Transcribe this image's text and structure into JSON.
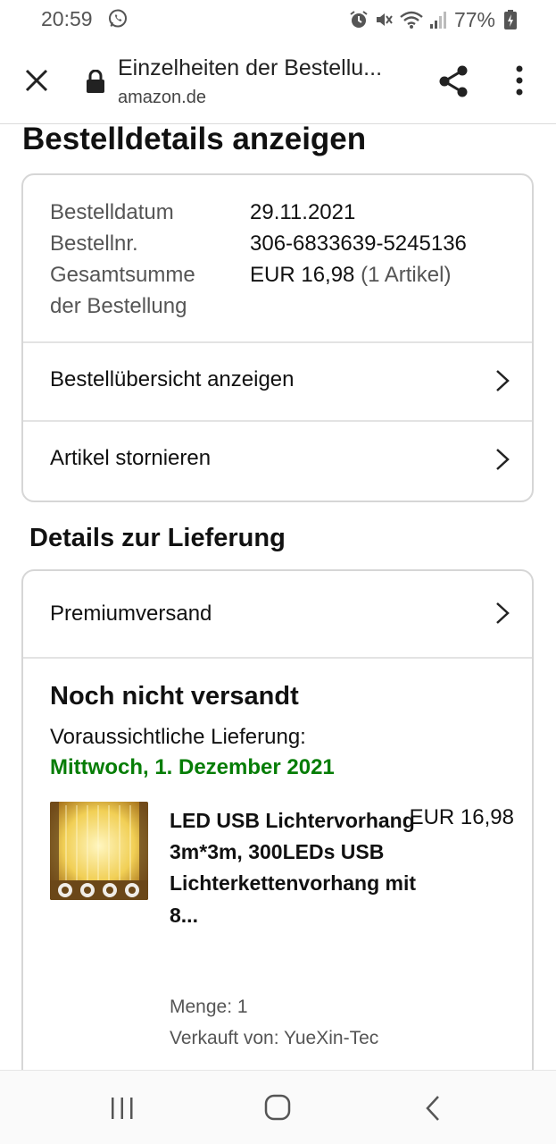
{
  "status_bar": {
    "time": "20:59",
    "battery": "77%",
    "icons": [
      "whatsapp-icon",
      "alarm-icon",
      "mute-icon",
      "wifi-icon",
      "signal-icon",
      "battery-charging-icon"
    ]
  },
  "toolbar": {
    "title": "Einzelheiten der Bestellu...",
    "url": "amazon.de",
    "icons": [
      "close-icon",
      "lock-icon",
      "share-icon",
      "more-vert-icon"
    ]
  },
  "page": {
    "title": "Bestelldetails anzeigen"
  },
  "order_info": {
    "date_label": "Bestelldatum",
    "date_value": "29.11.2021",
    "number_label": "Bestellnr.",
    "number_value": "306-6833639-5245136",
    "total_label": "Gesamtsumme der Bestellung",
    "total_value": "EUR 16,98",
    "total_count": "(1 Artikel)"
  },
  "order_links": {
    "overview": "Bestellübersicht anzeigen",
    "cancel": "Artikel stornieren"
  },
  "delivery": {
    "section_title": "Details zur Lieferung",
    "shipping_method": "Premiumversand",
    "status": "Noch nicht versandt",
    "estimate_label": "Voraussichtliche Lieferung:",
    "estimate_date": "Mittwoch, 1. Dezember 2021"
  },
  "product": {
    "name": "LED USB Lichtervorhang 3m*3m, 300LEDs USB Lichterkettenvorhang mit 8...",
    "price": "EUR 16,98",
    "quantity": "Menge: 1",
    "seller": "Verkauft von: YueXin-Tec"
  },
  "colors": {
    "delivery_green": "#067d06",
    "text": "#111111",
    "muted": "#555555",
    "border": "#d6d6d6"
  }
}
